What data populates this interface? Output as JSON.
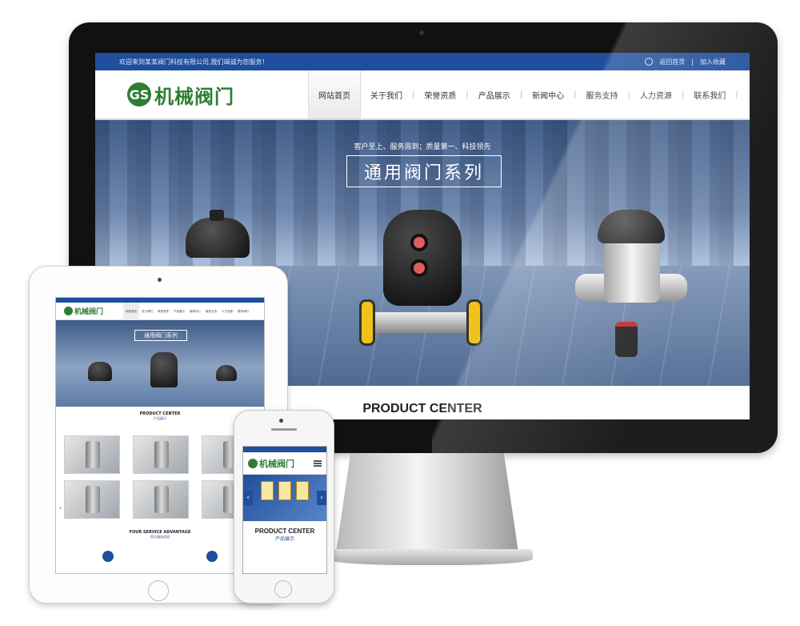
{
  "desktop": {
    "topbar": {
      "welcome": "欢迎来到某某阀门科技有限公司,我们竭诚为您服务！",
      "home_link": "返回首页",
      "divider": "|",
      "favorite_link": "加入收藏"
    },
    "logo": {
      "mark": "GS",
      "text": "机械阀门"
    },
    "nav": [
      {
        "label": "网站首页",
        "active": true
      },
      {
        "label": "关于我们"
      },
      {
        "label": "荣誉资质"
      },
      {
        "label": "产品展示"
      },
      {
        "label": "新闻中心"
      },
      {
        "label": "服务支持"
      },
      {
        "label": "人力资源"
      },
      {
        "label": "联系我们"
      }
    ],
    "banner": {
      "tagline": "客户至上、服务周到；质量第一、科技领先",
      "title": "通用阀门系列"
    },
    "section_title": "PRODUCT CENTER"
  },
  "tablet": {
    "logo_text": "机械阀门",
    "nav": [
      "网站首页",
      "关于我们",
      "荣誉资质",
      "产品展示",
      "新闻中心",
      "服务支持",
      "人力资源",
      "联系我们"
    ],
    "banner_title": "通用阀门系列",
    "product_title": "PRODUCT CENTER",
    "product_sub": "产品展示",
    "advantage_title": "FOUR SERVICE ADVANTAGE",
    "advantage_sub": "四大服务优势",
    "arrow": "‹"
  },
  "phone": {
    "logo_text": "机械阀门",
    "product_title": "PRODUCT CENTER",
    "product_sub": "产品展示",
    "arrow_left": "‹",
    "arrow_right": "›"
  },
  "colors": {
    "primary": "#1f4e9c",
    "brand_green": "#2e7d32"
  }
}
